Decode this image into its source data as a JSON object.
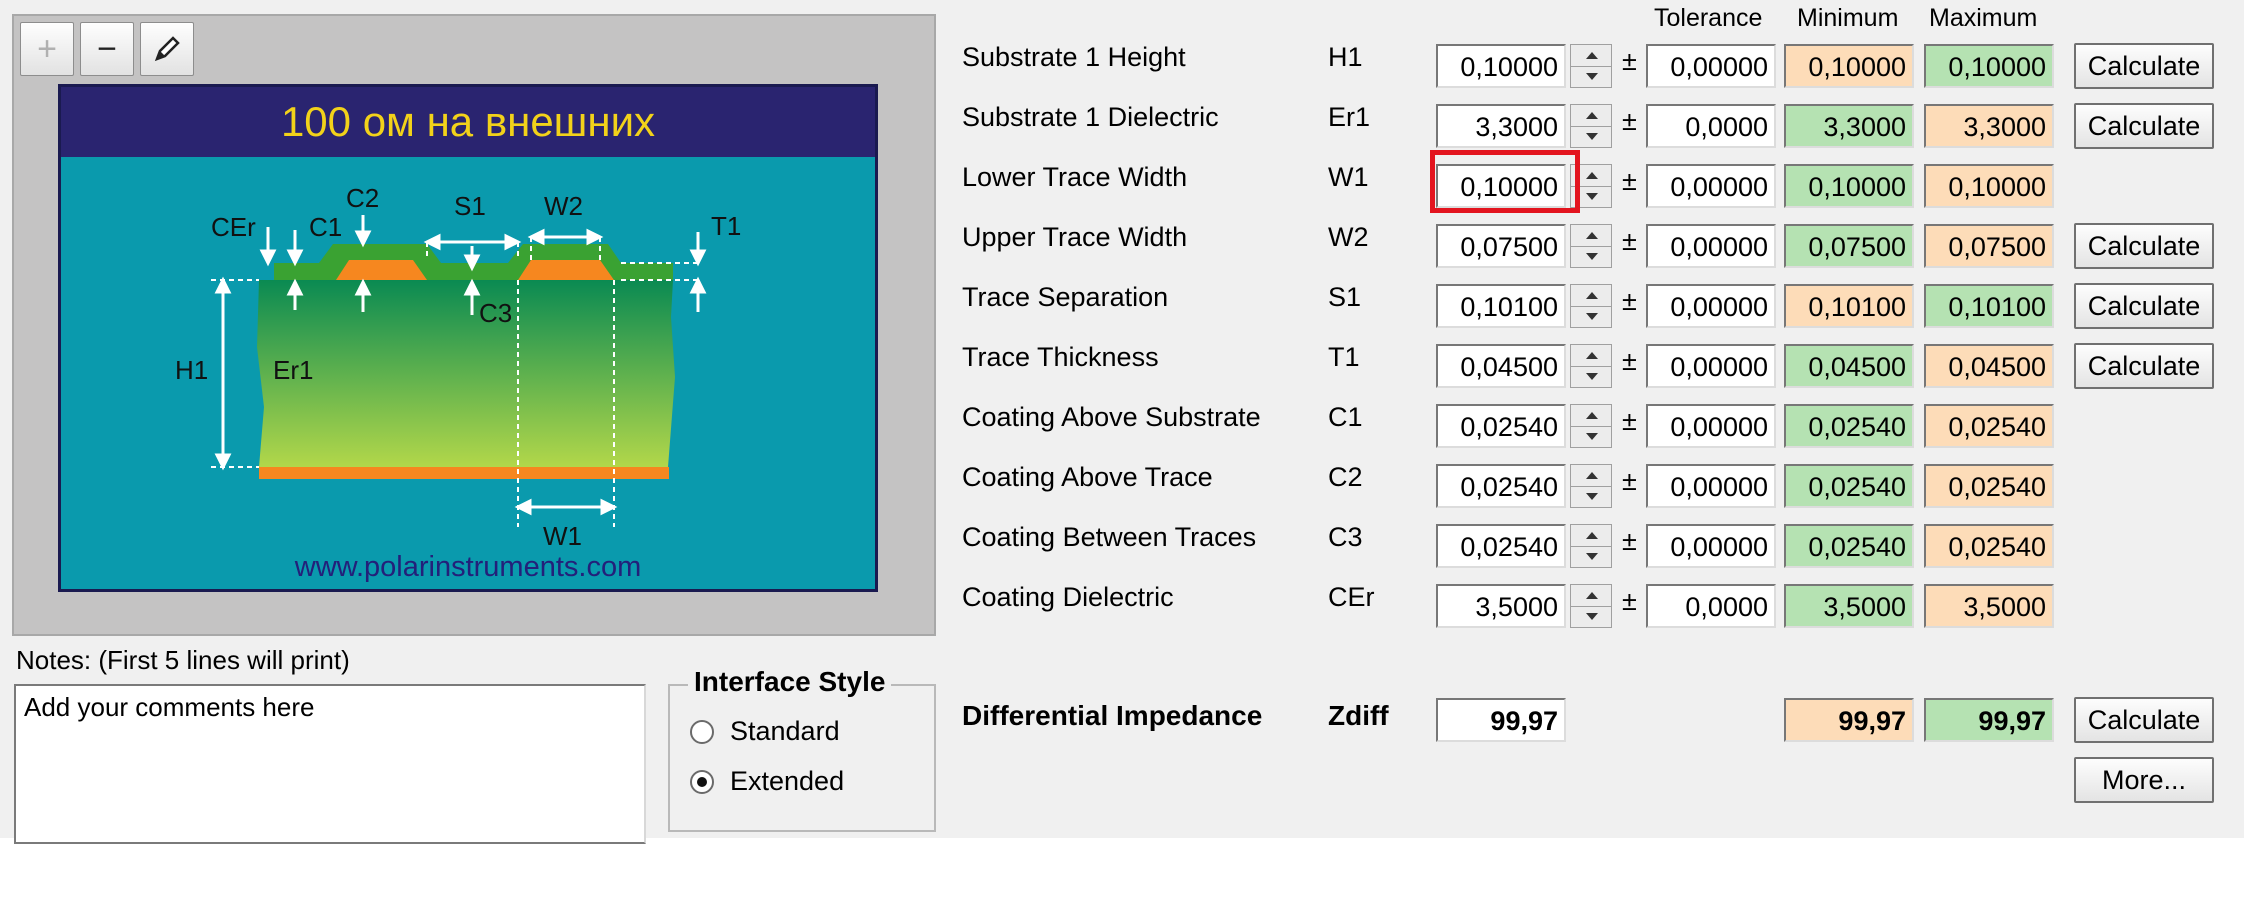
{
  "toolbar": {
    "zoom_in": "+",
    "zoom_out": "−"
  },
  "diagram": {
    "title": "100 ом на внешних",
    "url": "www.polarinstruments.com",
    "labels": {
      "cer": "CEr",
      "c1": "C1",
      "c2": "C2",
      "s1": "S1",
      "w2": "W2",
      "t1": "T1",
      "c3": "C3",
      "h1": "H1",
      "er1": "Er1",
      "w1": "W1"
    }
  },
  "notes": {
    "label": "Notes: (First 5 lines will print)",
    "text": "Add your comments here"
  },
  "interface_style": {
    "title": "Interface Style",
    "options": [
      "Standard",
      "Extended"
    ],
    "selected": "Extended"
  },
  "columns": {
    "tolerance": "Tolerance",
    "minimum": "Minimum",
    "maximum": "Maximum"
  },
  "plus_minus": "±",
  "calculate_label": "Calculate",
  "params": [
    {
      "label": "Substrate 1 Height",
      "symbol": "H1",
      "value": "0,10000",
      "tolerance": "0,00000",
      "min": "0,10000",
      "max": "0,10000",
      "min_color": "orange",
      "max_color": "green",
      "calc": true
    },
    {
      "label": "Substrate 1 Dielectric",
      "symbol": "Er1",
      "value": "3,3000",
      "tolerance": "0,0000",
      "min": "3,3000",
      "max": "3,3000",
      "min_color": "green",
      "max_color": "orange",
      "calc": true
    },
    {
      "label": "Lower Trace Width",
      "symbol": "W1",
      "value": "0,10000",
      "tolerance": "0,00000",
      "min": "0,10000",
      "max": "0,10000",
      "min_color": "green",
      "max_color": "orange",
      "calc": false
    },
    {
      "label": "Upper Trace Width",
      "symbol": "W2",
      "value": "0,07500",
      "tolerance": "0,00000",
      "min": "0,07500",
      "max": "0,07500",
      "min_color": "green",
      "max_color": "orange",
      "calc": true
    },
    {
      "label": "Trace Separation",
      "symbol": "S1",
      "value": "0,10100",
      "tolerance": "0,00000",
      "min": "0,10100",
      "max": "0,10100",
      "min_color": "orange",
      "max_color": "green",
      "calc": true
    },
    {
      "label": "Trace Thickness",
      "symbol": "T1",
      "value": "0,04500",
      "tolerance": "0,00000",
      "min": "0,04500",
      "max": "0,04500",
      "min_color": "green",
      "max_color": "orange",
      "calc": true
    },
    {
      "label": "Coating Above Substrate",
      "symbol": "C1",
      "value": "0,02540",
      "tolerance": "0,00000",
      "min": "0,02540",
      "max": "0,02540",
      "min_color": "green",
      "max_color": "orange",
      "calc": false
    },
    {
      "label": "Coating Above Trace",
      "symbol": "C2",
      "value": "0,02540",
      "tolerance": "0,00000",
      "min": "0,02540",
      "max": "0,02540",
      "min_color": "green",
      "max_color": "orange",
      "calc": false
    },
    {
      "label": "Coating Between Traces",
      "symbol": "C3",
      "value": "0,02540",
      "tolerance": "0,00000",
      "min": "0,02540",
      "max": "0,02540",
      "min_color": "green",
      "max_color": "orange",
      "calc": false
    },
    {
      "label": "Coating Dielectric",
      "symbol": "CEr",
      "value": "3,5000",
      "tolerance": "0,0000",
      "min": "3,5000",
      "max": "3,5000",
      "min_color": "green",
      "max_color": "orange",
      "calc": false
    }
  ],
  "result": {
    "label": "Differential Impedance",
    "symbol": "Zdiff",
    "value": "99,97",
    "min": "99,97",
    "max": "99,97",
    "calc_label": "Calculate",
    "more_label": "More..."
  },
  "colors": {
    "orange_field": "#fddcb8",
    "green_field": "#b5e2b2",
    "highlight": "#e3151f",
    "diagram_bg": "#0a9aad",
    "title_bar": "#2a2470",
    "title_text": "#f2d21a"
  }
}
